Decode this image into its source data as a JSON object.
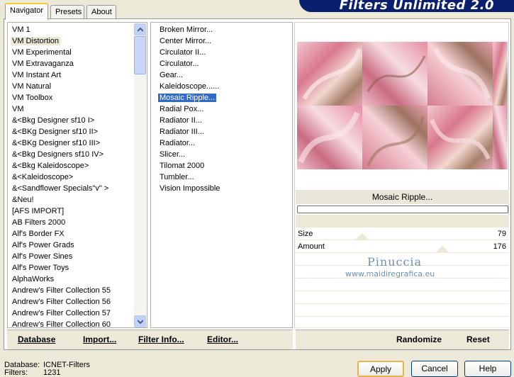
{
  "tabs": [
    {
      "label": "Navigator",
      "active": true
    },
    {
      "label": "Presets",
      "active": false
    },
    {
      "label": "About",
      "active": false
    }
  ],
  "banner_title": "Filters Unlimited 2.0",
  "categories": [
    {
      "label": "VM 1"
    },
    {
      "label": "VM Distortion",
      "selected": true
    },
    {
      "label": "VM Experimental"
    },
    {
      "label": "VM Extravaganza"
    },
    {
      "label": "VM Instant Art"
    },
    {
      "label": "VM Natural"
    },
    {
      "label": "VM Toolbox"
    },
    {
      "label": "VM"
    },
    {
      "label": "&<Bkg Designer sf10 I>"
    },
    {
      "label": "&<BKg Designer sf10 II>"
    },
    {
      "label": "&<BKg Designer sf10 III>"
    },
    {
      "label": "&<Bkg Designers sf10 IV>"
    },
    {
      "label": "&<Bkg Kaleidoscope>"
    },
    {
      "label": "&<Kaleidoscope>"
    },
    {
      "label": "&<Sandflower Specials\"v\" >"
    },
    {
      "label": "&Neu!"
    },
    {
      "label": "[AFS IMPORT]"
    },
    {
      "label": "AB Filters 2000"
    },
    {
      "label": "Alf's Border FX"
    },
    {
      "label": "Alf's Power Grads"
    },
    {
      "label": "Alf's Power Sines"
    },
    {
      "label": "Alf's Power Toys"
    },
    {
      "label": "AlphaWorks"
    },
    {
      "label": "Andrew's Filter Collection 55"
    },
    {
      "label": "Andrew's Filter Collection 56"
    },
    {
      "label": "Andrew's Filter Collection 57"
    },
    {
      "label": "Andrew's Filter Collection 60"
    }
  ],
  "filters": [
    {
      "label": "Broken Mirror..."
    },
    {
      "label": "Center Mirror..."
    },
    {
      "label": "Circulator II..."
    },
    {
      "label": "Circulator..."
    },
    {
      "label": "Gear..."
    },
    {
      "label": "Kaleidoscope......"
    },
    {
      "label": "Mosaic Ripple...",
      "highlighted": true
    },
    {
      "label": "Radial Pox..."
    },
    {
      "label": "Radiator II..."
    },
    {
      "label": "Radiator III..."
    },
    {
      "label": "Radiator..."
    },
    {
      "label": "Slicer..."
    },
    {
      "label": "Tilomat 2000"
    },
    {
      "label": "Tumbler..."
    },
    {
      "label": "Vision Impossible"
    }
  ],
  "left_buttons": {
    "database": "Database",
    "import": "Import...",
    "filter_info": "Filter Info...",
    "editor": "Editor..."
  },
  "preview": {
    "filter_name": "Mosaic Ripple...",
    "progress": 0,
    "colors": {
      "pink": "#e8a0b0",
      "rose": "#d67b8f",
      "cream": "#f2d7cf",
      "tan": "#a6806a"
    }
  },
  "params": [
    {
      "label": "Size",
      "value": "79"
    },
    {
      "label": "Amount",
      "value": "176"
    }
  ],
  "watermark": {
    "line1": "Pinuccia",
    "line2": "www.maidiregrafica.eu"
  },
  "right_buttons": {
    "randomize": "Randomize",
    "reset": "Reset"
  },
  "status": {
    "database_label": "Database:",
    "database_value": "ICNET-Filters",
    "filters_label": "Filters:",
    "filters_value": "1231"
  },
  "dialog_buttons": {
    "apply": "Apply",
    "cancel": "Cancel",
    "help": "Help"
  }
}
